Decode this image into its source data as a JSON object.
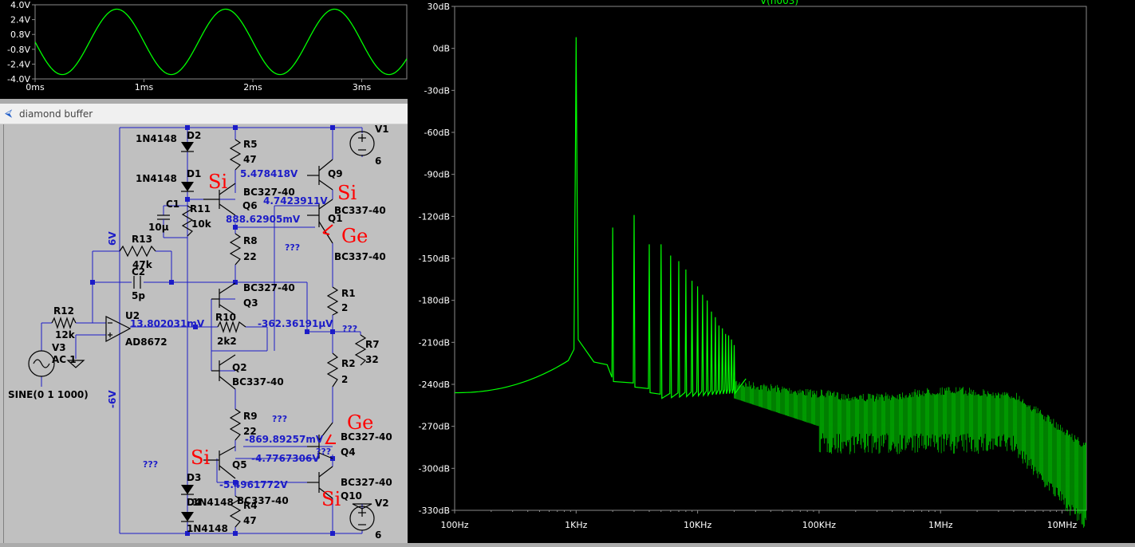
{
  "waveform_plot": {
    "y_ticks": [
      "4.0V",
      "2.4V",
      "0.8V",
      "-0.8V",
      "-2.4V",
      "-4.0V"
    ],
    "x_ticks": [
      "0ms",
      "1ms",
      "2ms",
      "3ms"
    ],
    "trace_color": "#00ff00"
  },
  "fft_plot": {
    "trace_label": "V(n003)",
    "y_ticks": [
      "30dB",
      "0dB",
      "-30dB",
      "-60dB",
      "-90dB",
      "-120dB",
      "-150dB",
      "-180dB",
      "-210dB",
      "-240dB",
      "-270dB",
      "-300dB",
      "-330dB"
    ],
    "x_ticks": [
      "100Hz",
      "1KHz",
      "10KHz",
      "100KHz",
      "1MHz",
      "10MHz"
    ],
    "trace_color": "#00ff00"
  },
  "schematic_window": {
    "title": "diamond buffer",
    "icon": "schematic-icon"
  },
  "schematic": {
    "components": {
      "D2": {
        "name": "D2",
        "model": "1N4148"
      },
      "D1": {
        "name": "D1",
        "model": "1N4148"
      },
      "D3": {
        "name": "D3",
        "model": "1N4148"
      },
      "D4": {
        "name": "D4",
        "model": "1N4148"
      },
      "R5": {
        "name": "R5",
        "value": "47"
      },
      "R8": {
        "name": "R8",
        "value": "22"
      },
      "R9": {
        "name": "R9",
        "value": "22"
      },
      "R4": {
        "name": "R4",
        "value": "47"
      },
      "R11": {
        "name": "R11",
        "value": "10k"
      },
      "R13": {
        "name": "R13",
        "value": "47k"
      },
      "R12": {
        "name": "R12",
        "value": "12k"
      },
      "R10": {
        "name": "R10",
        "value": "2k2"
      },
      "R1": {
        "name": "R1",
        "value": "2"
      },
      "R2": {
        "name": "R2",
        "value": "2"
      },
      "R7": {
        "name": "R7",
        "value": "32"
      },
      "C1": {
        "name": "C1",
        "value": "10µ"
      },
      "C2": {
        "name": "C2",
        "value": "5p"
      },
      "Q9": {
        "name": "Q9",
        "model": "BC337-40"
      },
      "Q6": {
        "name": "Q6",
        "model": "BC327-40"
      },
      "Q1": {
        "name": "Q1",
        "model": "BC337-40"
      },
      "Q3": {
        "name": "Q3",
        "model": "BC327-40"
      },
      "Q2": {
        "name": "Q2",
        "model": "BC337-40"
      },
      "Q4": {
        "name": "Q4",
        "model": "BC327-40"
      },
      "Q5": {
        "name": "Q5",
        "model": "BC337-40"
      },
      "Q10": {
        "name": "Q10",
        "model": "BC327-40"
      },
      "U2": {
        "name": "U2",
        "model": "AD8672"
      },
      "V1": {
        "name": "V1",
        "value": "6"
      },
      "V2": {
        "name": "V2",
        "value": "6"
      },
      "V3": {
        "name": "V3",
        "value": "AC 1",
        "source": "SINE(0 1 1000)"
      }
    },
    "node_voltages": {
      "v1": "5.478418V",
      "v2": "4.7423911V",
      "v3": "888.62905mV",
      "v4": "13.802031mV",
      "v5": "-362.36191µV",
      "v6": "-869.89257mV",
      "v7": "-4.7767306V",
      "v8": "-5.4961772V"
    },
    "rail_labels": {
      "pos": "6V",
      "neg": "-6V"
    },
    "unknown_marker": "???",
    "annotations": {
      "a1": "Si",
      "a2": "Si",
      "a3": "Ge",
      "a4": "Ge",
      "a5": "Si",
      "a6": "Si"
    }
  }
}
